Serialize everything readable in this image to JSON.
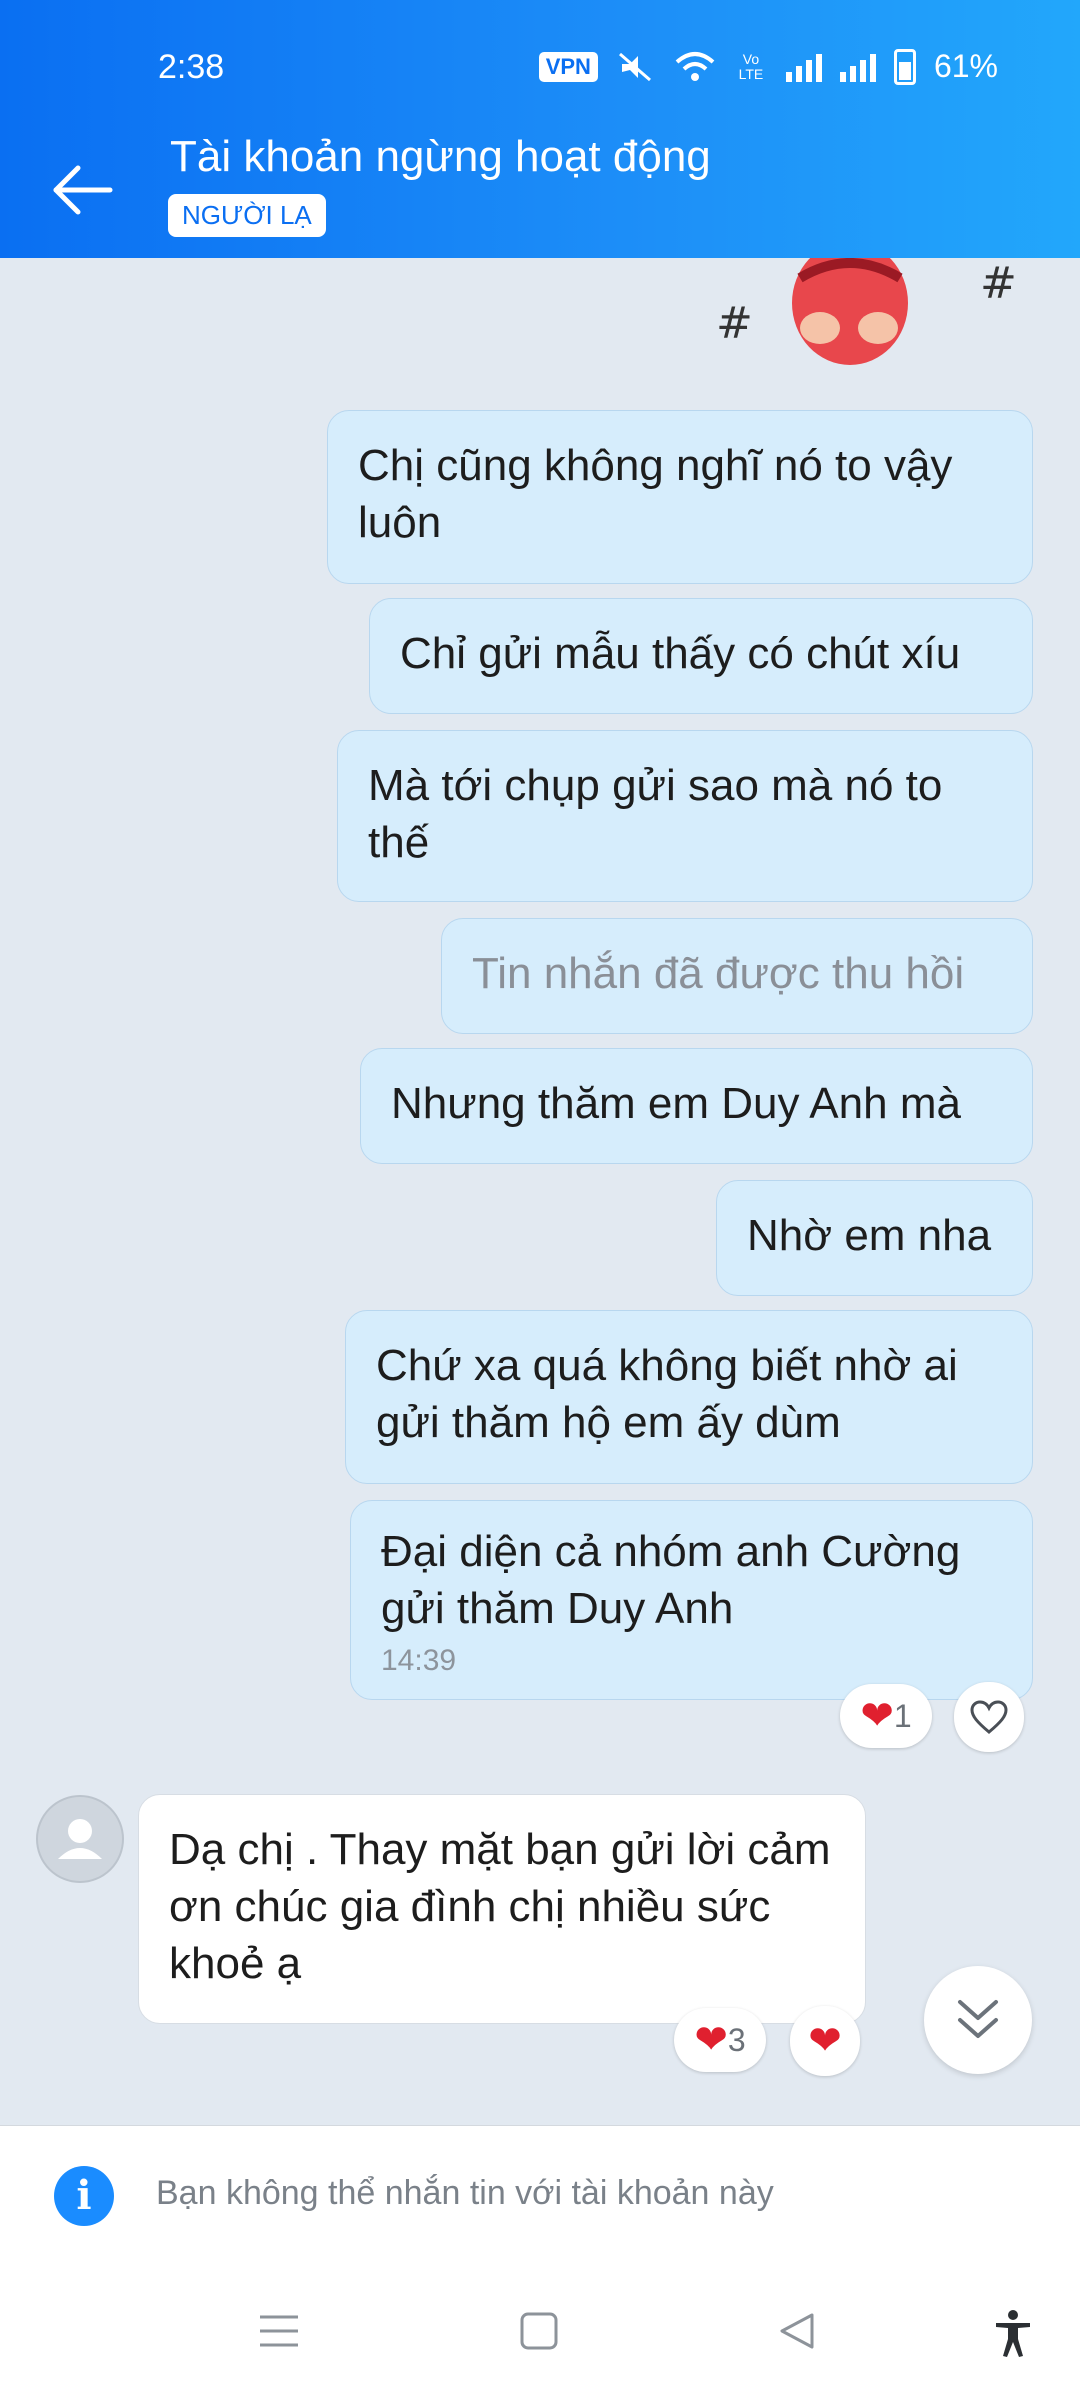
{
  "status_bar": {
    "time": "2:38",
    "vpn": "VPN",
    "volte": "Vo LTE",
    "battery": "61%"
  },
  "header": {
    "title": "Tài khoản ngừng hoạt động",
    "badge": "NGƯỜI LẠ"
  },
  "messages": {
    "m1": "Chị cũng không nghĩ nó to vậy luôn",
    "m2": "Chỉ gửi mẫu thấy có chút xíu",
    "m3": "Mà tới chụp gửi sao mà nó to thế",
    "m4": "Tin nhắn đã được thu hồi",
    "m5": "Nhưng thăm em Duy Anh mà",
    "m6": "Nhờ em nha",
    "m7": "Chứ xa quá không biết nhờ ai gửi thăm hộ em ấy dùm",
    "m8": "Đại diện cả nhóm anh Cường gửi thăm Duy Anh",
    "m8_time": "14:39",
    "m8_reaction_count": "1",
    "reply": "Dạ chị . Thay mặt bạn gửi lời cảm ơn chúc gia đình chị nhiều sức khoẻ ạ",
    "reply_reaction_count": "3"
  },
  "notice": {
    "text": "Bạn không thể nhắn tin với tài khoản này"
  },
  "colors": {
    "header_start": "#0a6ff2",
    "header_end": "#22a7fb",
    "outgoing_bubble": "#d6edfc",
    "incoming_bubble": "#ffffff",
    "background": "#e2e9f1",
    "heart": "#e0202f"
  }
}
